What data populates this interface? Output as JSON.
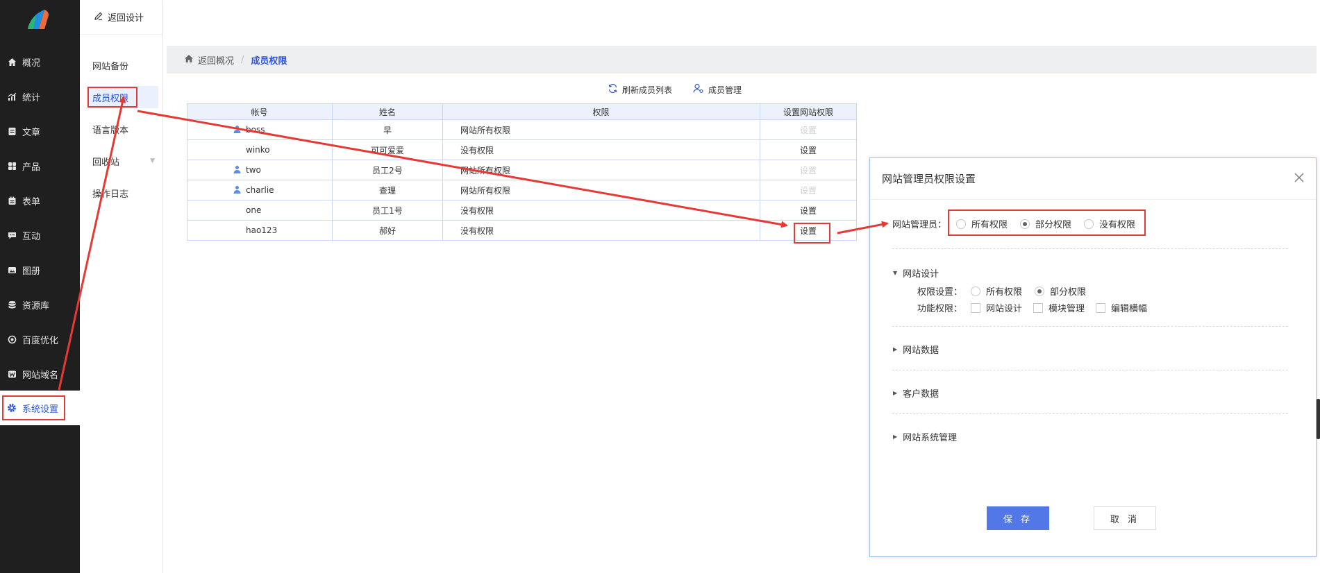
{
  "sidebar": {
    "items": [
      {
        "label": "概况",
        "icon": "home-icon"
      },
      {
        "label": "统计",
        "icon": "stats-icon"
      },
      {
        "label": "文章",
        "icon": "article-icon"
      },
      {
        "label": "产品",
        "icon": "product-icon"
      },
      {
        "label": "表单",
        "icon": "form-icon"
      },
      {
        "label": "互动",
        "icon": "chat-icon"
      },
      {
        "label": "图册",
        "icon": "album-icon"
      },
      {
        "label": "资源库",
        "icon": "database-icon"
      },
      {
        "label": "百度优化",
        "icon": "seo-icon"
      },
      {
        "label": "网站域名",
        "icon": "domain-icon"
      },
      {
        "label": "系统设置",
        "icon": "gear-icon"
      }
    ]
  },
  "subnav": {
    "back_label": "返回设计",
    "items": [
      {
        "label": "网站备份"
      },
      {
        "label": "成员权限"
      },
      {
        "label": "语言版本"
      },
      {
        "label": "回收站"
      },
      {
        "label": "操作日志"
      }
    ]
  },
  "breadcrumb": {
    "back": "返回概况",
    "current": "成员权限"
  },
  "toolbar": {
    "refresh": "刷新成员列表",
    "manage": "成员管理"
  },
  "table": {
    "headers": [
      "帐号",
      "姓名",
      "权限",
      "设置网站权限"
    ],
    "rows": [
      {
        "account": "boss",
        "name": "早",
        "perm": "网站所有权限",
        "action": "设置"
      },
      {
        "account": "winko",
        "name": "可可爱爱",
        "perm": "没有权限",
        "action": "设置"
      },
      {
        "account": "two",
        "name": "员工2号",
        "perm": "网站所有权限",
        "action": "设置"
      },
      {
        "account": "charlie",
        "name": "查理",
        "perm": "网站所有权限",
        "action": "设置"
      },
      {
        "account": "one",
        "name": "员工1号",
        "perm": "没有权限",
        "action": "设置"
      },
      {
        "account": "hao123",
        "name": "郝好",
        "perm": "没有权限",
        "action": "设置"
      }
    ]
  },
  "modal": {
    "title": "网站管理员权限设置",
    "admin_label": "网站管理员：",
    "options": [
      "所有权限",
      "部分权限",
      "没有权限"
    ],
    "selected_option": "部分权限",
    "sections": {
      "design": {
        "title": "网站设计",
        "perm_label": "权限设置：",
        "perm_options": [
          "所有权限",
          "部分权限"
        ],
        "func_label": "功能权限：",
        "func_options": [
          "网站设计",
          "模块管理",
          "编辑横幅"
        ]
      },
      "data": {
        "title": "网站数据"
      },
      "customer": {
        "title": "客户数据"
      },
      "system": {
        "title": "网站系统管理"
      }
    },
    "save": "保 存",
    "cancel": "取 消"
  },
  "colors": {
    "accent": "#2f55d4",
    "annotation": "#e53935",
    "sidebar_bg": "#1f1f1f"
  }
}
